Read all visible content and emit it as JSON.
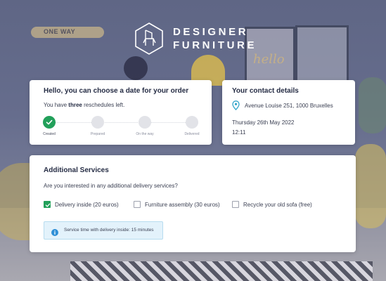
{
  "brand": {
    "line1": "DESIGNER",
    "line2": "FURNITURE",
    "icon": "chair-hexagon-logo-icon"
  },
  "background": {
    "sign_text": "ONE WAY"
  },
  "order_card": {
    "title": "Hello, you can choose a date for your order",
    "reschedule_prefix": "You have ",
    "reschedule_count": "three",
    "reschedule_suffix": " reschedules left.",
    "steps": [
      {
        "label": "Created",
        "done": true
      },
      {
        "label": "Prepared",
        "done": false
      },
      {
        "label": "On the way",
        "done": false
      },
      {
        "label": "Delivered",
        "done": false
      }
    ],
    "accent_color": "#22a05a"
  },
  "contact_card": {
    "title": "Your contact details",
    "address": "Avenue Louise 251, 1000 Bruxelles",
    "date": "Thursday  26th May 2022",
    "time": "12:11",
    "pin_color": "#2fa4c9"
  },
  "services_card": {
    "title": "Additional Services",
    "question": "Are you interested in any additional delivery services?",
    "options": [
      {
        "label": "Delivery inside (20 euros)",
        "checked": true
      },
      {
        "label": "Furniture assembly (30 euros)",
        "checked": false
      },
      {
        "label": "Recycle your old sofa (free)",
        "checked": false
      }
    ],
    "info": "Service time with delivery inside: 15 minutes",
    "info_color": "#2f8fd6"
  }
}
